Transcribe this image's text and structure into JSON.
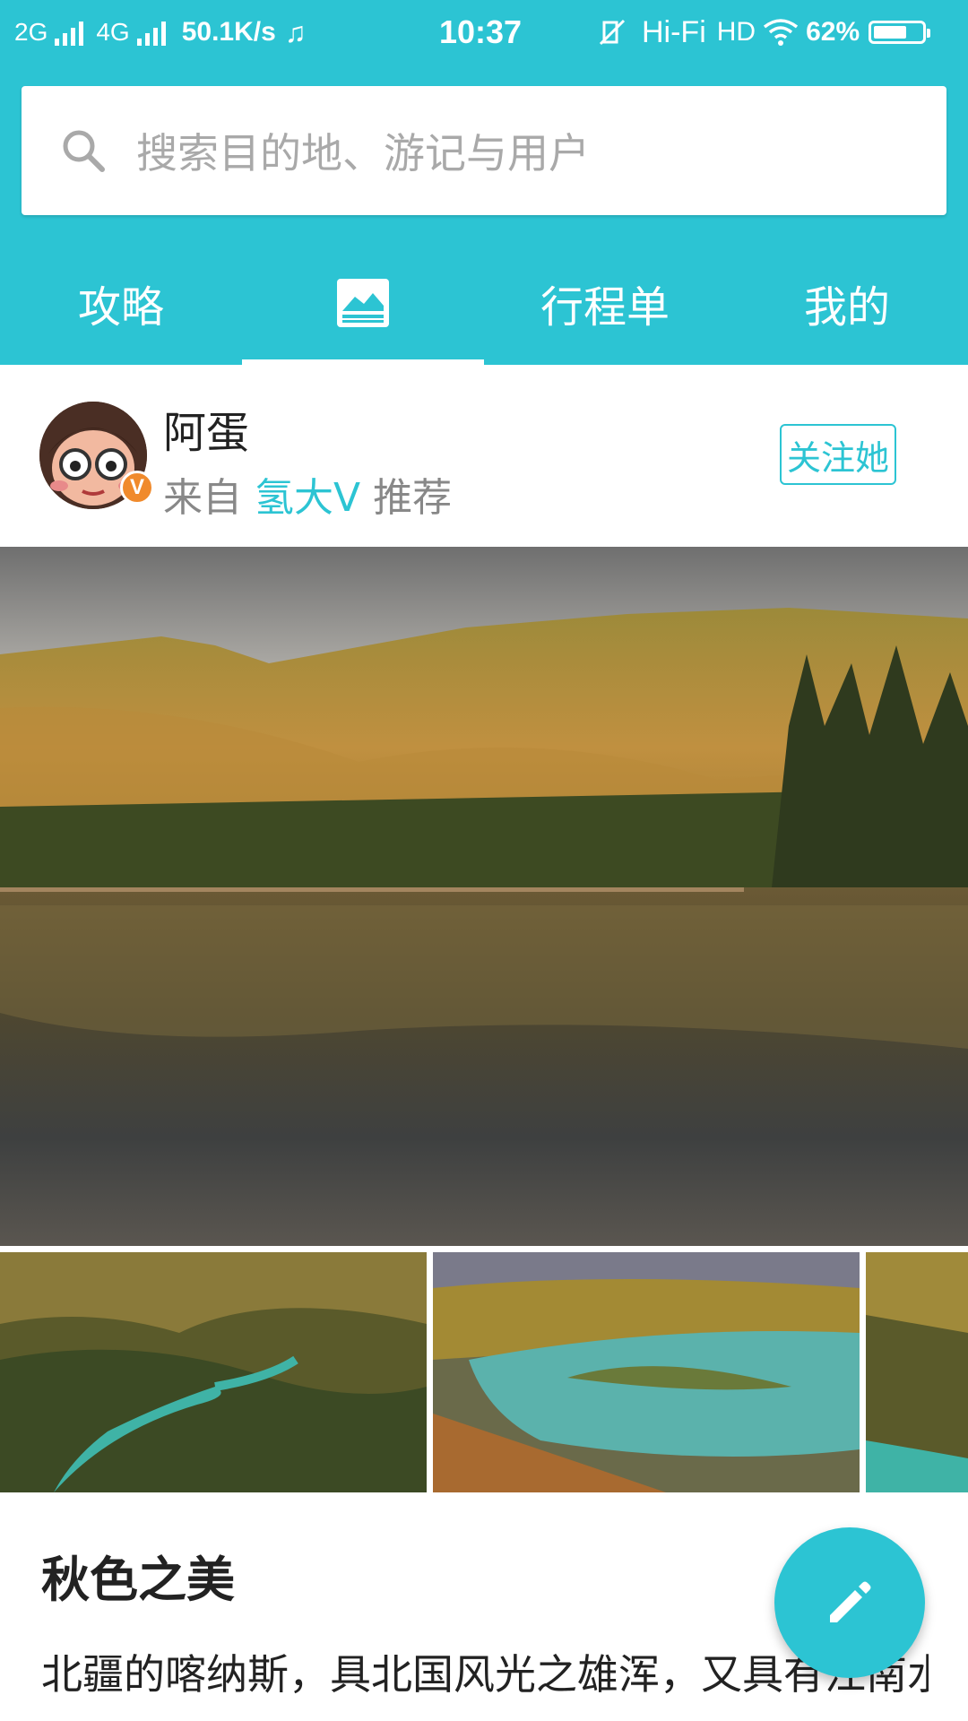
{
  "status_bar": {
    "net1": "2G",
    "net2": "4G",
    "speed": "50.1K/s",
    "music_icon": "music-note-icon",
    "time": "10:37",
    "mute_icon": "vibrate-off-icon",
    "hifi": "Hi-Fi",
    "hd": "HD",
    "wifi_icon": "wifi-icon",
    "battery_pct": "62%",
    "battery_level": 0.62
  },
  "search": {
    "icon": "search-icon",
    "placeholder": "搜索目的地、游记与用户"
  },
  "tabs": [
    {
      "label": "攻略",
      "active": false
    },
    {
      "label": "",
      "icon": "image-icon",
      "active": true
    },
    {
      "label": "行程单",
      "active": false
    },
    {
      "label": "我的",
      "active": false
    }
  ],
  "post": {
    "author_name": "阿蛋",
    "verified_badge": "V",
    "sub_prefix": "来自",
    "sub_source": "氢大V",
    "sub_suffix": "推荐",
    "follow_label": "关注她",
    "title": "秋色之美",
    "body": "北疆的喀纳斯，具北国风光之雄浑，又具有江南水乡之娇秀，还有\"云海佛光\"、\"变色湖\""
  },
  "fab": {
    "icon": "edit-pencil-icon"
  },
  "colors": {
    "accent": "#2cc4d3",
    "badge": "#f08a2c"
  }
}
